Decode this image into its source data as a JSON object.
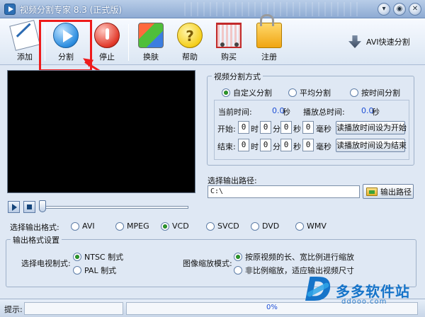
{
  "window": {
    "title": "视频分割专家 8.3 (正式版)",
    "minimize_glyph": "▾",
    "restore_glyph": "◉",
    "close_glyph": "✕"
  },
  "toolbar": {
    "items": [
      {
        "label": "添加",
        "icon": "add-file-icon"
      },
      {
        "label": "分割",
        "icon": "play-icon"
      },
      {
        "label": "停止",
        "icon": "stop-icon"
      },
      {
        "label": "换肤",
        "icon": "skin-icon"
      },
      {
        "label": "帮助",
        "icon": "help-icon"
      },
      {
        "label": "购买",
        "icon": "cart-icon"
      },
      {
        "label": "注册",
        "icon": "lock-icon"
      }
    ],
    "avi_fast_split": "AVI快速分割"
  },
  "split_mode": {
    "title": "视频分割方式",
    "options": [
      "自定义分割",
      "平均分割",
      "按时间分割"
    ],
    "selected": "自定义分割",
    "current_time_label": "当前时间:",
    "current_time_value": "0.0",
    "total_time_label": "播放总时间:",
    "total_time_value": "0.0",
    "seconds_unit": "秒",
    "start": {
      "label": "开始:",
      "hour": "0",
      "hour_unit": "时",
      "minute": "0",
      "minute_unit": "分",
      "second": "0",
      "second_unit": "秒",
      "ms": "0",
      "ms_unit": "毫秒",
      "button": "读播放时间设为开始"
    },
    "end": {
      "label": "结束:",
      "hour": "0",
      "hour_unit": "时",
      "minute": "0",
      "minute_unit": "分",
      "second": "0",
      "second_unit": "秒",
      "ms": "0",
      "ms_unit": "毫秒",
      "button": "读播放时间设为结束"
    }
  },
  "output": {
    "path_label": "选择输出路径:",
    "path_value": "C:\\",
    "path_button": "输出路径"
  },
  "output_format": {
    "label": "选择输出格式:",
    "options": [
      "AVI",
      "MPEG",
      "VCD",
      "SVCD",
      "DVD",
      "WMV"
    ],
    "selected": "VCD"
  },
  "format_settings": {
    "title": "输出格式设置",
    "tv_label": "选择电视制式:",
    "tv_options": [
      "NTSC 制式",
      "PAL  制式"
    ],
    "tv_selected": "NTSC 制式",
    "scale_label": "图像缩放模式:",
    "scale_options": [
      "按原视频的长、宽比例进行缩放",
      "非比例缩放，适应输出视频尺寸"
    ],
    "scale_selected": "按原视频的长、宽比例进行缩放"
  },
  "statusbar": {
    "label": "提示:",
    "progress": "0%"
  },
  "watermark": {
    "name": "多多软件站",
    "url": "ddooo.com"
  },
  "colors": {
    "highlight": "#ee1b1b",
    "value_text": "#1d4fd6",
    "radio_dot": "#2a9a2a"
  }
}
